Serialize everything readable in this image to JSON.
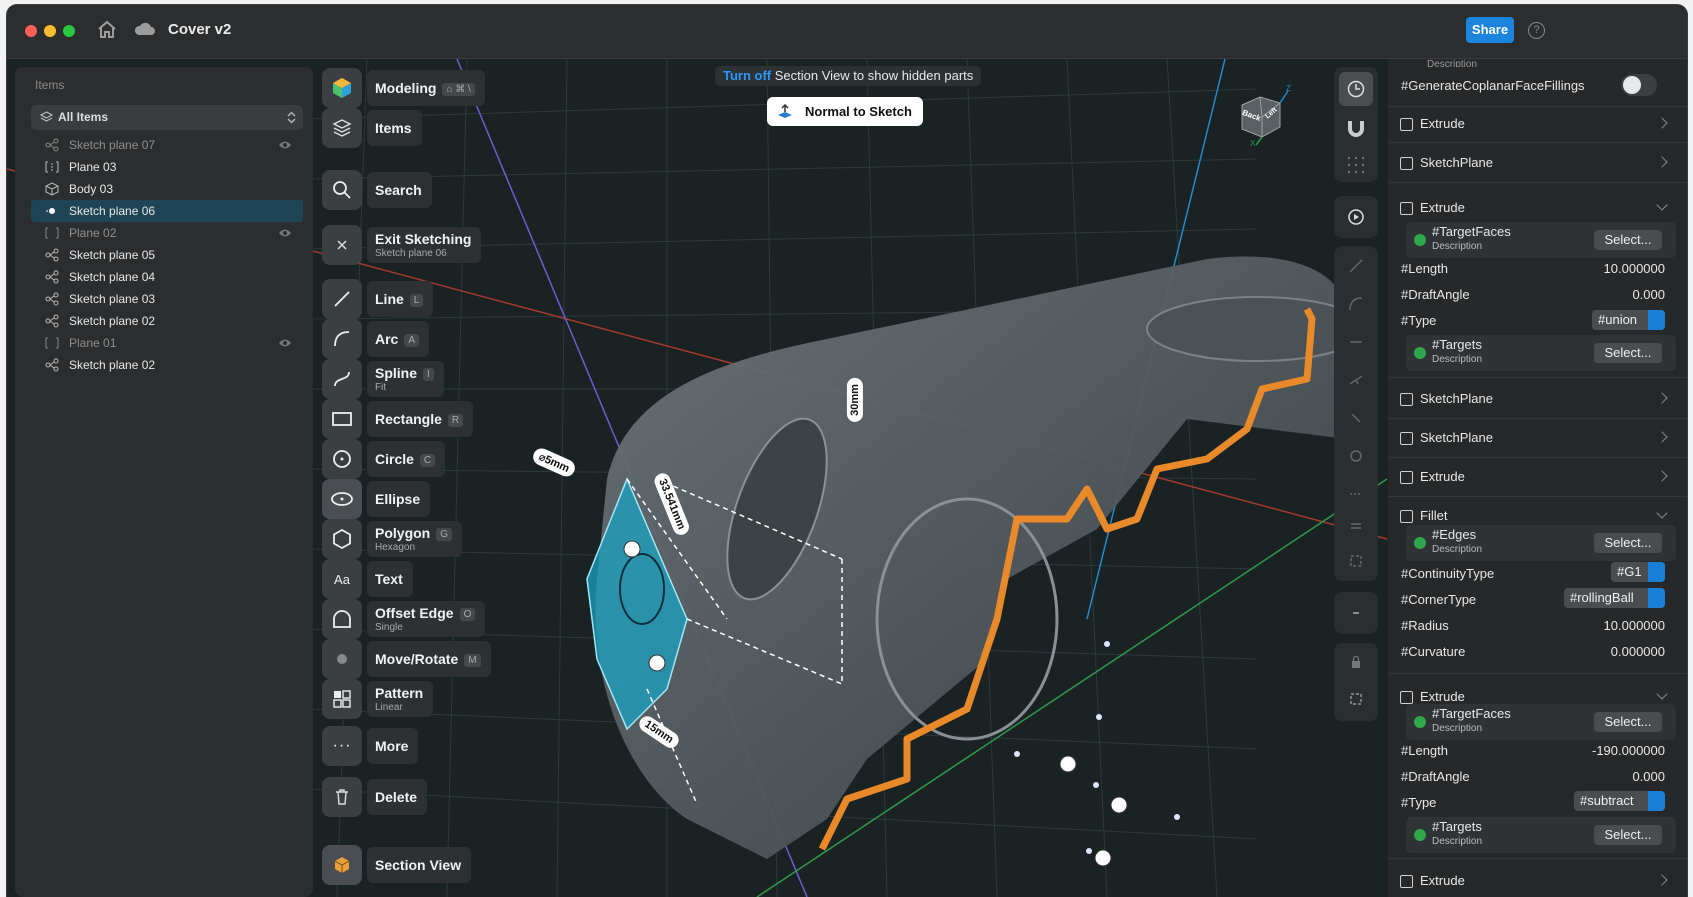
{
  "window": {
    "title": "Cover v2",
    "share_label": "Share"
  },
  "left_panel": {
    "header": "Items",
    "filter": "All Items",
    "items": [
      {
        "label": "Sketch plane 07",
        "dim": true,
        "icon": "sketch-icon"
      },
      {
        "label": "Plane 03",
        "dim": false,
        "icon": "plane-icon"
      },
      {
        "label": "Body 03",
        "dim": false,
        "icon": "body-icon"
      },
      {
        "label": "Sketch plane 06",
        "dim": false,
        "icon": "sketch-icon",
        "selected": true
      },
      {
        "label": "Plane 02",
        "dim": true,
        "icon": "plane-icon"
      },
      {
        "label": "Sketch plane 05",
        "dim": false,
        "icon": "sketch-icon"
      },
      {
        "label": "Sketch plane 04",
        "dim": false,
        "icon": "sketch-icon"
      },
      {
        "label": "Sketch plane 03",
        "dim": false,
        "icon": "sketch-icon"
      },
      {
        "label": "Sketch plane 02",
        "dim": false,
        "icon": "sketch-icon"
      },
      {
        "label": "Plane 01",
        "dim": true,
        "icon": "plane-icon"
      },
      {
        "label": "Sketch plane 02",
        "dim": false,
        "icon": "sketch-icon"
      }
    ]
  },
  "toolbar": {
    "modeling": "Modeling",
    "modeling_keys": "⌂ ⌘ \\",
    "items": "Items",
    "search": "Search",
    "exit_sketching": "Exit Sketching",
    "exit_sub": "Sketch plane 06",
    "line": "Line",
    "line_key": "L",
    "arc": "Arc",
    "arc_key": "A",
    "spline": "Spline",
    "spline_key": "I",
    "spline_sub": "Fit",
    "rectangle": "Rectangle",
    "rectangle_key": "R",
    "circle": "Circle",
    "circle_key": "C",
    "ellipse": "Ellipse",
    "polygon": "Polygon",
    "polygon_key": "G",
    "polygon_sub": "Hexagon",
    "text": "Text",
    "offset_edge": "Offset Edge",
    "offset_key": "O",
    "offset_sub": "Single",
    "move_rotate": "Move/Rotate",
    "move_key": "M",
    "pattern": "Pattern",
    "pattern_sub": "Linear",
    "more": "More",
    "delete": "Delete",
    "section_view": "Section View"
  },
  "banner": {
    "action": "Turn off",
    "text": "Section View to show hidden parts"
  },
  "normal_to_sketch": "Normal to Sketch",
  "view_cube": {
    "back": "Back",
    "left": "Left",
    "z": "Z",
    "x": "X"
  },
  "dimensions": {
    "d1": "⌀5mm",
    "d2": "33.541mm",
    "d3": "30mm",
    "d4": "15mm"
  },
  "right_panel": {
    "top_desc": "Description",
    "generate_label": "#GenerateCoplanarFaceFillings",
    "select_label": "Select...",
    "description": "Description",
    "features": [
      {
        "name": "Extrude"
      },
      {
        "name": "SketchPlane"
      },
      {
        "name": "Extrude",
        "expanded": true,
        "target_faces": "#TargetFaces",
        "length_label": "#Length",
        "length": "10.000000",
        "draft_label": "#DraftAngle",
        "draft": "0.000",
        "type_label": "#Type",
        "type": "#union",
        "targets": "#Targets"
      },
      {
        "name": "SketchPlane"
      },
      {
        "name": "SketchPlane"
      },
      {
        "name": "Extrude"
      },
      {
        "name": "Fillet",
        "expanded": true,
        "edges": "#Edges",
        "continuity_label": "#ContinuityType",
        "continuity": "#G1",
        "corner_label": "#CornerType",
        "corner": "#rollingBall",
        "radius_label": "#Radius",
        "radius": "10.000000",
        "curvature_label": "#Curvature",
        "curvature": "0.000000"
      },
      {
        "name": "Extrude",
        "expanded": true,
        "target_faces": "#TargetFaces",
        "length_label": "#Length",
        "length": "-190.000000",
        "draft_label": "#DraftAngle",
        "draft": "0.000",
        "type_label": "#Type",
        "type": "#subtract",
        "targets": "#Targets"
      },
      {
        "name": "Extrude"
      }
    ]
  },
  "colors": {
    "accent": "#1a7fd6",
    "orange": "#e88a2a",
    "teal": "#1aa3c2",
    "green_status": "#2ea84a"
  }
}
